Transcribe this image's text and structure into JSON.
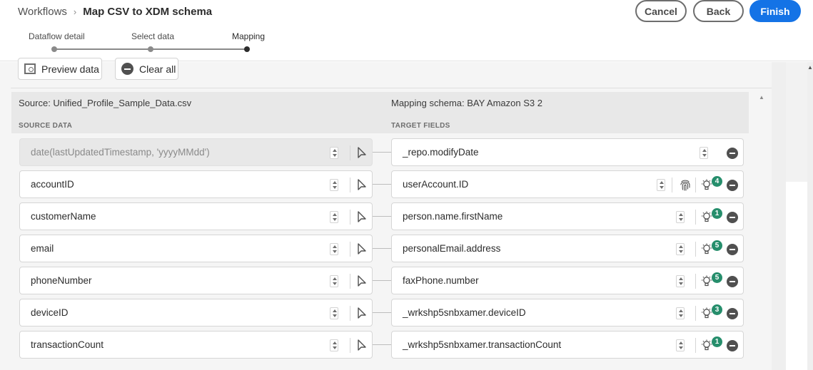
{
  "header": {
    "breadcrumb_root": "Workflows",
    "breadcrumb_separator": "›",
    "title": "Map CSV to XDM schema",
    "cancel_label": "Cancel",
    "back_label": "Back",
    "finish_label": "Finish"
  },
  "steps": [
    {
      "label": "Dataflow detail",
      "state": "done"
    },
    {
      "label": "Select data",
      "state": "done"
    },
    {
      "label": "Mapping",
      "state": "current"
    }
  ],
  "toolbar": {
    "preview_label": "Preview data",
    "clear_label": "Clear all"
  },
  "mapping": {
    "source_title": "Source: Unified_Profile_Sample_Data.csv",
    "target_title": "Mapping schema: BAY Amazon S3 2",
    "source_column": "SOURCE DATA",
    "target_column": "TARGET FIELDS",
    "rows": [
      {
        "source": "date(lastUpdatedTimestamp, 'yyyyMMdd')",
        "target": "_repo.modifyDate",
        "source_disabled": true,
        "suggestions": null,
        "identity": false
      },
      {
        "source": "accountID",
        "target": "userAccount.ID",
        "source_disabled": false,
        "suggestions": "4",
        "identity": true
      },
      {
        "source": "customerName",
        "target": "person.name.firstName",
        "source_disabled": false,
        "suggestions": "1",
        "identity": false
      },
      {
        "source": "email",
        "target": "personalEmail.address",
        "source_disabled": false,
        "suggestions": "5",
        "identity": false
      },
      {
        "source": "phoneNumber",
        "target": "faxPhone.number",
        "source_disabled": false,
        "suggestions": "5",
        "identity": false
      },
      {
        "source": "deviceID",
        "target": "_wrkshp5snbxamer.deviceID",
        "source_disabled": false,
        "suggestions": "3",
        "identity": false
      },
      {
        "source": "transactionCount",
        "target": "_wrkshp5snbxamer.transactionCount",
        "source_disabled": false,
        "suggestions": "1",
        "identity": false
      }
    ]
  },
  "colors": {
    "primary": "#1473e6",
    "badge": "#268e6c"
  }
}
